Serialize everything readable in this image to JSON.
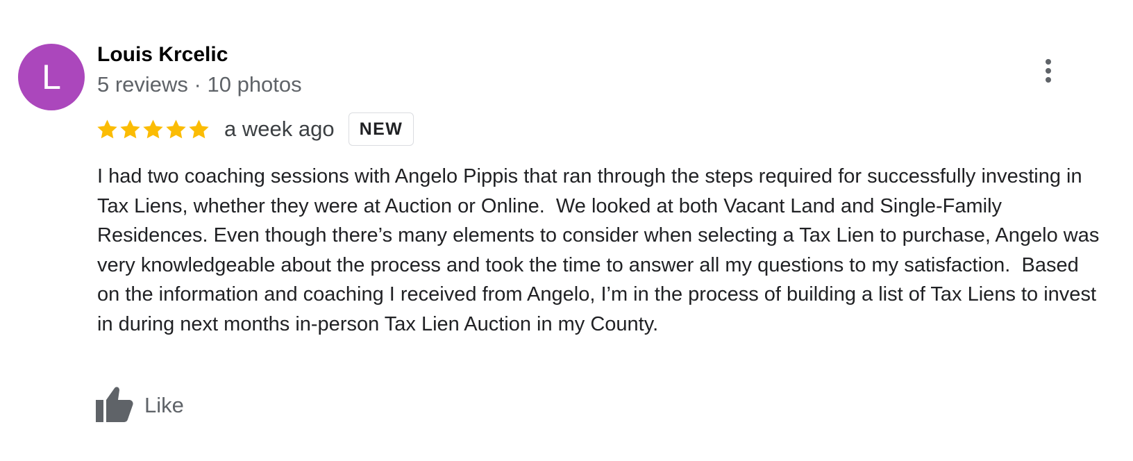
{
  "review": {
    "reviewer": {
      "initial": "L",
      "name": "Louis Krcelic",
      "meta": "5 reviews · 10 photos",
      "avatar_color": "#ab47bc"
    },
    "rating": {
      "stars": 5,
      "max_stars": 5,
      "star_color": "#fbbc04"
    },
    "date": "a week ago",
    "badge": "NEW",
    "text": "I had two coaching sessions with Angelo Pippis that ran through the steps required for successfully investing in Tax Liens, whether they were at Auction or Online.  We looked at both Vacant Land and Single-Family Residences. Even though there’s many elements to consider when selecting a Tax Lien to purchase, Angelo was very knowledgeable about the process and took the time to answer all my questions to my satisfaction.  Based on the information and coaching I received from Angelo, I’m in the process of building a list of Tax Liens to invest in during next months in-person Tax Lien Auction in my County.",
    "actions": {
      "more_icon": "more-vert-icon",
      "like_icon": "thumbs-up-icon",
      "like_label": "Like",
      "icon_color": "#5f6368"
    }
  }
}
